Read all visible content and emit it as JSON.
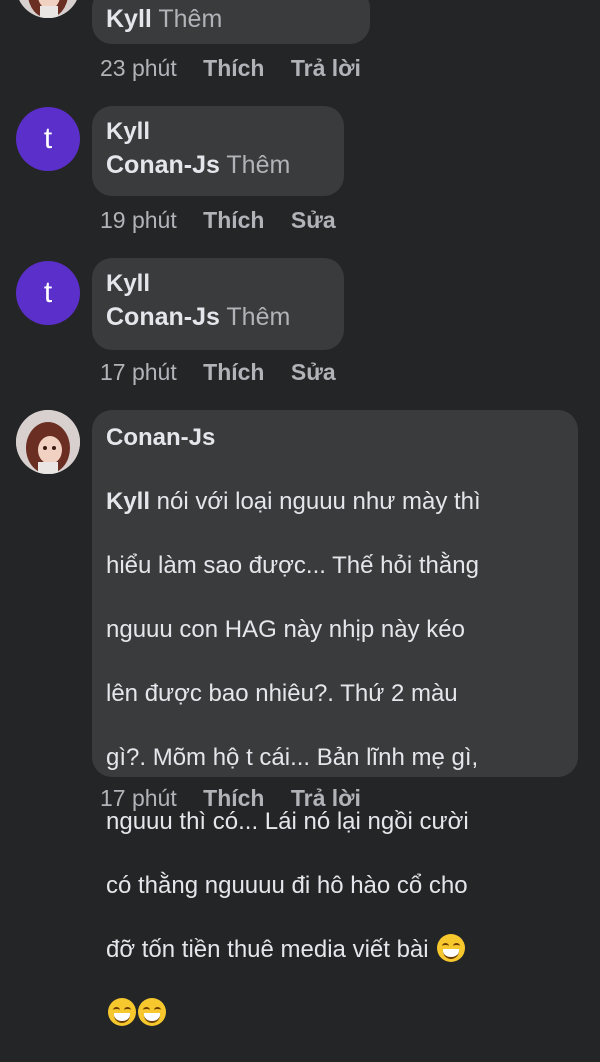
{
  "comments": [
    {
      "avatar": {
        "type": "photo"
      },
      "author": "",
      "lines": [
        {
          "mention": "Kyll",
          "more": "Thêm"
        }
      ],
      "meta": {
        "time": "23 phút",
        "like": "Thích",
        "action": "Trả lời"
      }
    },
    {
      "avatar": {
        "type": "letter",
        "letter": "t",
        "color": "#5b2fc9"
      },
      "author": "Kyll",
      "lines": [
        {
          "mention": "Conan-Js",
          "more": "Thêm"
        }
      ],
      "meta": {
        "time": "19 phút",
        "like": "Thích",
        "action": "Sửa"
      }
    },
    {
      "avatar": {
        "type": "letter",
        "letter": "t",
        "color": "#5b2fc9"
      },
      "author": "Kyll",
      "lines": [
        {
          "mention": "Conan-Js",
          "more": "Thêm"
        }
      ],
      "meta": {
        "time": "17 phút",
        "like": "Thích",
        "action": "Sửa"
      }
    },
    {
      "avatar": {
        "type": "photo"
      },
      "author": "Conan-Js",
      "mention": "Kyll",
      "text_lines": [
        " nói với loại nguuu như mày thì",
        "hiểu làm sao được... Thế hỏi thằng",
        "nguuu con HAG này nhịp này kéo",
        "lên được bao nhiêu?. Thứ 2 màu",
        "gì?. Mõm hộ t cái... Bản lĩnh mẹ gì,",
        "nguuu thì có... Lái nó lại ngồi cười",
        "có thằng nguuuu đi hô hào cổ cho",
        "đỡ tốn tiền thuê media viết bài"
      ],
      "emoji": "grinning-face",
      "meta": {
        "time": "17 phút",
        "like": "Thích",
        "action": "Trả lời"
      }
    }
  ]
}
